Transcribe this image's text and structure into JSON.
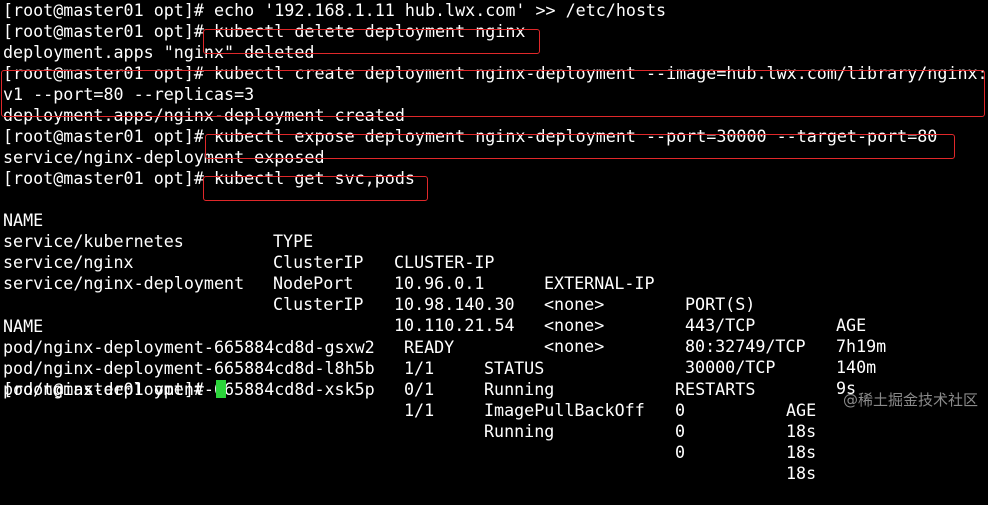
{
  "terminal": {
    "lines": {
      "l0": "[root@master01 opt]# echo '192.168.1.11 hub.lwx.com' >> /etc/hosts",
      "l1": "[root@master01 opt]# kubectl delete deployment nginx",
      "l2": "deployment.apps \"nginx\" deleted",
      "l3": "[root@master01 opt]# kubectl create deployment nginx-deployment --image=hub.lwx.com/library/nginx:",
      "l4": "v1 --port=80 --replicas=3",
      "l5": "deployment.apps/nginx-deployment created",
      "l6": "[root@master01 opt]# kubectl expose deployment nginx-deployment --port=30000 --target-port=80",
      "l7": "service/nginx-deployment exposed",
      "l8": "[root@master01 opt]# kubectl get svc,pods",
      "l22": "[root@master01 opt]#"
    },
    "svc_table": {
      "headers": [
        "NAME",
        "TYPE",
        "CLUSTER-IP",
        "EXTERNAL-IP",
        "PORT(S)",
        "AGE"
      ],
      "rows": [
        [
          "service/kubernetes",
          "ClusterIP",
          "10.96.0.1",
          "<none>",
          "443/TCP",
          "7h19m"
        ],
        [
          "service/nginx",
          "NodePort",
          "10.98.140.30",
          "<none>",
          "80:32749/TCP",
          "140m"
        ],
        [
          "service/nginx-deployment",
          "ClusterIP",
          "10.110.21.54",
          "<none>",
          "30000/TCP",
          "9s"
        ]
      ]
    },
    "pod_table": {
      "headers": [
        "NAME",
        "READY",
        "STATUS",
        "RESTARTS",
        "AGE"
      ],
      "rows": [
        [
          "pod/nginx-deployment-665884cd8d-gsxw2",
          "1/1",
          "Running",
          "0",
          "18s"
        ],
        [
          "pod/nginx-deployment-665884cd8d-l8h5b",
          "0/1",
          "ImagePullBackOff",
          "0",
          "18s"
        ],
        [
          "pod/nginx-deployment-665884cd8d-xsk5p",
          "1/1",
          "Running",
          "0",
          "18s"
        ]
      ]
    }
  },
  "watermark": "@稀土掘金技术社区",
  "colors": {
    "background": "#000000",
    "text": "#ffffff",
    "highlight_box": "#e0282a",
    "cursor": "#2bd43a"
  }
}
